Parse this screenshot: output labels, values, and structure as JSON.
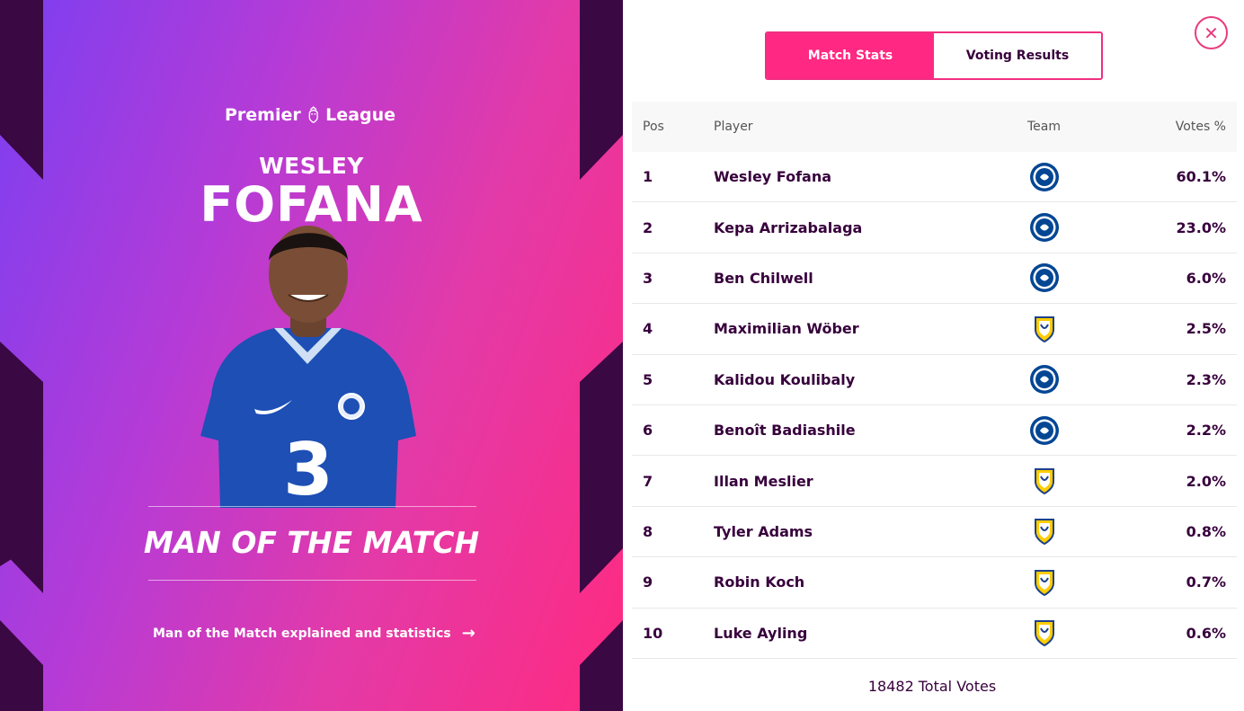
{
  "brand": {
    "logo_left": "Premier",
    "logo_right": "League"
  },
  "hero": {
    "first_name": "WESLEY",
    "last_name": "FOFANA",
    "award": "MAN OF THE MATCH",
    "explain_link": "Man of the Match explained and statistics"
  },
  "tabs": [
    {
      "label": "Match Stats",
      "active": true
    },
    {
      "label": "Voting Results",
      "active": false
    }
  ],
  "table": {
    "headers": {
      "pos": "Pos",
      "player": "Player",
      "team": "Team",
      "votes": "Votes %"
    },
    "rows": [
      {
        "pos": "1",
        "player": "Wesley Fofana",
        "team": "chelsea-crest-icon",
        "votes": "60.1%"
      },
      {
        "pos": "2",
        "player": "Kepa Arrizabalaga",
        "team": "chelsea-crest-icon",
        "votes": "23.0%"
      },
      {
        "pos": "3",
        "player": "Ben Chilwell",
        "team": "chelsea-crest-icon",
        "votes": "6.0%"
      },
      {
        "pos": "4",
        "player": "Maximilian Wöber",
        "team": "leeds-crest-icon",
        "votes": "2.5%"
      },
      {
        "pos": "5",
        "player": "Kalidou Koulibaly",
        "team": "chelsea-crest-icon",
        "votes": "2.3%"
      },
      {
        "pos": "6",
        "player": "Benoît Badiashile",
        "team": "chelsea-crest-icon",
        "votes": "2.2%"
      },
      {
        "pos": "7",
        "player": "Illan Meslier",
        "team": "leeds-crest-icon",
        "votes": "2.0%"
      },
      {
        "pos": "8",
        "player": "Tyler Adams",
        "team": "leeds-crest-icon",
        "votes": "0.8%"
      },
      {
        "pos": "9",
        "player": "Robin Koch",
        "team": "leeds-crest-icon",
        "votes": "0.7%"
      },
      {
        "pos": "10",
        "player": "Luke Ayling",
        "team": "leeds-crest-icon",
        "votes": "0.6%"
      }
    ]
  },
  "total": {
    "count": "18482",
    "label": "Total Votes"
  },
  "colors": {
    "accent": "#ff2882",
    "purple": "#37003c",
    "chelsea": "#034694",
    "leeds": "#ffcd00"
  }
}
